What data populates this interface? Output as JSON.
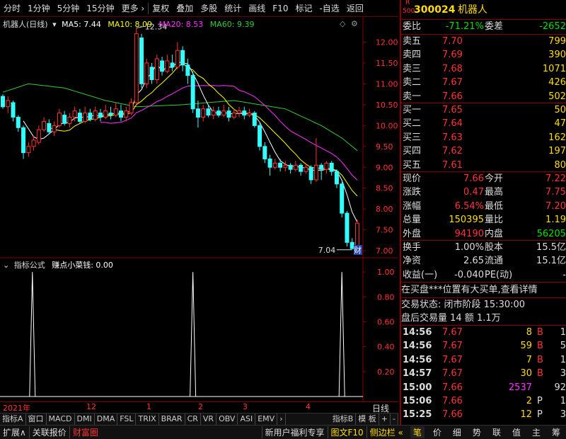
{
  "toolbar": {
    "items": [
      "分时",
      "1分钟",
      "5分钟",
      "15分钟",
      "更多 ›",
      "复权",
      "叠加",
      "多股",
      "统计",
      "画线",
      "F10",
      "标记",
      "-自选",
      "返回"
    ]
  },
  "stock": {
    "badge_top": "R",
    "badge_bottom": "500",
    "code": "300024",
    "name": "机器人"
  },
  "legend": {
    "name": "机器人(日线)",
    "ma5": "MA5: 7.44",
    "ma10": "MA10: 8.09",
    "ma20": "MA20: 8.53",
    "ma60": "MA60: 9.39",
    "colors": {
      "ma5": "#ffffff",
      "ma10": "#ffff00",
      "ma20": "#ff33ff",
      "ma60": "#33cc33"
    }
  },
  "indicator": {
    "title": "指标公式",
    "name": "赚点小菜钱: 0.00"
  },
  "annotations": {
    "high": "12.34",
    "low": "7.04",
    "cai": "财"
  },
  "chart_data": {
    "type": "candlestick",
    "price_axis": {
      "ticks": [
        "12.00",
        "11.50",
        "11.00",
        "10.50",
        "10.00",
        "9.50",
        "9.00",
        "8.50",
        "8.00",
        "7.50",
        "7.00"
      ],
      "ylim": [
        6.9,
        12.5
      ]
    },
    "indicator_axis": {
      "ticks": [
        "1.00",
        "0.80",
        "0.60",
        "0.40",
        "0.20"
      ],
      "ylim": [
        0,
        1.08
      ]
    },
    "date_labels": [
      "2021年",
      "12",
      "1",
      "2",
      "3",
      "4"
    ],
    "candles": [
      [
        10.7,
        10.45,
        10.75,
        10.4
      ],
      [
        10.45,
        10.6,
        10.7,
        10.3
      ],
      [
        10.55,
        10.2,
        10.6,
        10.1
      ],
      [
        10.2,
        9.95,
        10.25,
        9.85
      ],
      [
        9.95,
        9.35,
        10.0,
        9.2
      ],
      [
        9.35,
        9.5,
        9.6,
        9.25
      ],
      [
        9.5,
        9.65,
        9.75,
        9.4
      ],
      [
        9.6,
        9.9,
        10.0,
        9.55
      ],
      [
        9.9,
        10.1,
        10.2,
        9.85
      ],
      [
        10.05,
        9.85,
        10.15,
        9.8
      ],
      [
        9.85,
        10.0,
        10.1,
        9.75
      ],
      [
        10.0,
        10.3,
        10.4,
        9.95
      ],
      [
        10.25,
        10.05,
        10.35,
        10.0
      ],
      [
        10.05,
        10.2,
        10.3,
        9.95
      ],
      [
        10.2,
        10.35,
        10.45,
        10.1
      ],
      [
        10.3,
        10.1,
        10.4,
        10.05
      ],
      [
        10.1,
        10.3,
        10.45,
        10.05
      ],
      [
        10.3,
        10.15,
        10.4,
        10.1
      ],
      [
        10.15,
        10.35,
        10.45,
        10.1
      ],
      [
        10.3,
        10.2,
        10.4,
        10.1
      ],
      [
        10.2,
        10.35,
        10.5,
        10.15
      ],
      [
        10.3,
        10.25,
        10.45,
        10.15
      ],
      [
        10.25,
        10.4,
        10.55,
        10.2
      ],
      [
        10.35,
        10.2,
        10.5,
        10.1
      ],
      [
        10.2,
        10.35,
        10.45,
        10.1
      ],
      [
        10.3,
        10.55,
        10.65,
        10.25
      ],
      [
        10.55,
        12.2,
        12.34,
        10.5
      ],
      [
        12.1,
        11.0,
        12.2,
        10.9
      ],
      [
        11.0,
        11.5,
        11.6,
        10.9
      ],
      [
        11.4,
        11.1,
        11.5,
        11.0
      ],
      [
        11.1,
        11.6,
        11.7,
        11.0
      ],
      [
        11.55,
        11.3,
        11.65,
        11.2
      ],
      [
        11.3,
        11.55,
        11.7,
        11.25
      ],
      [
        11.5,
        11.4,
        11.7,
        11.3
      ],
      [
        11.4,
        11.8,
        12.0,
        11.35
      ],
      [
        11.8,
        11.45,
        11.9,
        11.3
      ],
      [
        11.45,
        11.2,
        11.6,
        11.0
      ],
      [
        11.2,
        10.4,
        11.3,
        10.3
      ],
      [
        10.4,
        10.2,
        10.6,
        9.95
      ],
      [
        10.2,
        10.4,
        10.5,
        10.1
      ],
      [
        10.4,
        10.25,
        10.5,
        10.2
      ],
      [
        10.25,
        10.35,
        10.45,
        10.15
      ],
      [
        10.35,
        10.25,
        10.45,
        10.2
      ],
      [
        10.25,
        10.35,
        10.5,
        10.2
      ],
      [
        10.35,
        10.2,
        10.45,
        10.1
      ],
      [
        10.2,
        10.3,
        10.4,
        10.15
      ],
      [
        10.3,
        10.35,
        10.45,
        10.2
      ],
      [
        10.35,
        10.25,
        10.45,
        10.15
      ],
      [
        10.25,
        10.3,
        10.4,
        10.2
      ],
      [
        10.3,
        10.0,
        10.35,
        9.95
      ],
      [
        10.0,
        9.5,
        10.05,
        9.4
      ],
      [
        9.5,
        9.2,
        9.6,
        9.1
      ],
      [
        9.2,
        9.0,
        9.3,
        8.8
      ],
      [
        9.0,
        9.1,
        9.2,
        8.95
      ],
      [
        9.1,
        9.0,
        9.2,
        8.9
      ],
      [
        9.0,
        9.05,
        9.15,
        8.9
      ],
      [
        9.05,
        8.95,
        9.1,
        8.85
      ],
      [
        8.95,
        9.05,
        9.15,
        8.9
      ],
      [
        9.05,
        8.9,
        9.1,
        8.8
      ],
      [
        8.9,
        9.0,
        9.1,
        8.85
      ],
      [
        9.0,
        8.7,
        9.05,
        8.6
      ],
      [
        8.7,
        9.05,
        9.7,
        8.65
      ],
      [
        9.05,
        8.95,
        9.1,
        8.7
      ],
      [
        8.95,
        9.1,
        9.15,
        8.85
      ],
      [
        9.1,
        8.9,
        9.15,
        8.8
      ],
      [
        8.9,
        8.6,
        8.95,
        8.5
      ],
      [
        8.6,
        7.9,
        8.65,
        7.8
      ],
      [
        7.9,
        7.2,
        7.95,
        7.1
      ],
      [
        7.2,
        7.05,
        7.3,
        7.04
      ],
      [
        7.05,
        7.66,
        7.75,
        7.05
      ]
    ],
    "ma60": [
      [
        0,
        10.8
      ],
      [
        5,
        11.0
      ],
      [
        12,
        10.9
      ],
      [
        20,
        10.6
      ],
      [
        26,
        10.45
      ],
      [
        35,
        10.5
      ],
      [
        45,
        10.6
      ],
      [
        55,
        10.4
      ],
      [
        62,
        10.0
      ],
      [
        66,
        9.7
      ],
      [
        69,
        9.4
      ]
    ],
    "signals": [
      3,
      37,
      66
    ]
  },
  "quote": {
    "wb_label": "委比",
    "wb_value": "-71.21%",
    "wc_label": "委差",
    "wc_value": "-2652",
    "sells": [
      {
        "label": "卖五",
        "price": "7.70",
        "vol": "799"
      },
      {
        "label": "卖四",
        "price": "7.69",
        "vol": "390"
      },
      {
        "label": "卖三",
        "price": "7.68",
        "vol": "1071"
      },
      {
        "label": "卖二",
        "price": "7.67",
        "vol": "426"
      },
      {
        "label": "卖一",
        "price": "7.66",
        "vol": "502"
      }
    ],
    "buys": [
      {
        "label": "买一",
        "price": "7.65",
        "vol": "50"
      },
      {
        "label": "买二",
        "price": "7.64",
        "vol": "47"
      },
      {
        "label": "买三",
        "price": "7.63",
        "vol": "162"
      },
      {
        "label": "买四",
        "price": "7.62",
        "vol": "197"
      },
      {
        "label": "买五",
        "price": "7.61",
        "vol": "80"
      }
    ],
    "stats": [
      {
        "l1": "现价",
        "v1": "7.66",
        "l2": "今开",
        "v2": "7.22"
      },
      {
        "l1": "涨跌",
        "v1": "0.47",
        "l2": "最高",
        "v2": "7.75"
      },
      {
        "l1": "涨幅",
        "v1": "6.54%",
        "l2": "最低",
        "v2": "7.20"
      },
      {
        "l1": "总量",
        "v1": "150395",
        "l2": "量比",
        "v2": "1.19"
      },
      {
        "l1": "外盘",
        "v1": "94190",
        "l2": "内盘",
        "v2": "56205"
      }
    ],
    "stats2": [
      {
        "l1": "换手",
        "v1": "1.00%",
        "l2": "股本",
        "v2": "15.5亿"
      },
      {
        "l1": "净资",
        "v1": "2.65",
        "l2": "流通",
        "v2": "15.1亿"
      },
      {
        "l1": "收益(一)",
        "v1": "-0.040",
        "l2": "PE(动)",
        "v2": "-"
      }
    ],
    "notice": "在买盘***位置有大买单,查看详情",
    "status": "交易状态: 闭市阶段 15:30:00",
    "after": "盘后交易量 14 额 1.1万",
    "ticks": [
      {
        "t": "14:56",
        "p": "7.67",
        "v": "8",
        "d": "B",
        "n": "1"
      },
      {
        "t": "14:56",
        "p": "7.67",
        "v": "59",
        "d": "B",
        "n": "5"
      },
      {
        "t": "14:56",
        "p": "7.67",
        "v": "7",
        "d": "B",
        "n": "1"
      },
      {
        "t": "14:57",
        "p": "7.67",
        "v": "30",
        "d": "B",
        "n": "3"
      },
      {
        "t": "15:00",
        "p": "7.66",
        "v": "2537",
        "d": "",
        "n": "92"
      },
      {
        "t": "15:06",
        "p": "7.66",
        "v": "2",
        "d": "P",
        "n": "1"
      },
      {
        "t": "15:25",
        "p": "7.66",
        "v": "12",
        "d": "P",
        "n": "3"
      }
    ]
  },
  "indicator_tabs": [
    "指标A",
    "窗口",
    "MACD",
    "DMI",
    "DMA",
    "FSL",
    "TRIX",
    "BRAR",
    "CR",
    "VR",
    "OBV",
    "ASI",
    "EMV",
    "›"
  ],
  "indicator_tabs_right": [
    "指标B",
    "模 板",
    "+",
    "-"
  ],
  "period": "日线",
  "bottom": {
    "left": [
      "扩展∧",
      "关联报价",
      "财富圈"
    ],
    "middle": [
      "新用户福利专享",
      "图文F10",
      "侧边栏 «"
    ],
    "right": [
      "笔",
      "价",
      "细",
      "势",
      "联",
      "值",
      "主",
      "筹"
    ]
  }
}
